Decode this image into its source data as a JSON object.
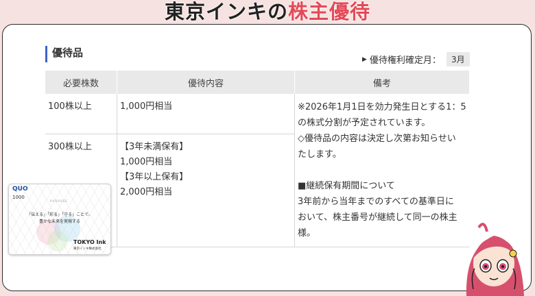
{
  "headline": {
    "part1": "東京インキの",
    "part2": "株主優待"
  },
  "section": {
    "title": "優待品"
  },
  "confirm": {
    "label": "優待権利確定月：",
    "month": "3月"
  },
  "table": {
    "headers": [
      "必要株数",
      "優待内容",
      "備考"
    ],
    "rows": [
      {
        "shares": "100株以上",
        "content": [
          "1,000円相当"
        ]
      },
      {
        "shares": "300株以上",
        "content": [
          "【3年未満保有】",
          "1,000円相当",
          "【3年以上保有】",
          "2,000円相当"
        ]
      }
    ],
    "notes": [
      "※2026年1月1日を効力発生日とする1：5",
      "の株式分割が予定されています。",
      "◇優待品の内容は決定し次第お知らせい",
      "たします。",
      "",
      "■継続保有期間について",
      "3年前から当年までのすべての基準日に",
      "おいて、株主番号が継続して同一の株主",
      "様。"
    ]
  },
  "quo_card": {
    "logo": "QUO",
    "amount": "1000",
    "purpose": "PURPOSE",
    "tagline1": "「伝える」「彩る」「守る」ことで、",
    "tagline2": "豊かな未来を実現する",
    "brand": "TOKYO Ink",
    "company": "東京インキ株式会社"
  },
  "colors": {
    "accent": "#3d62c8",
    "headline_red": "#e34a57",
    "background": "#f6e3e1"
  }
}
